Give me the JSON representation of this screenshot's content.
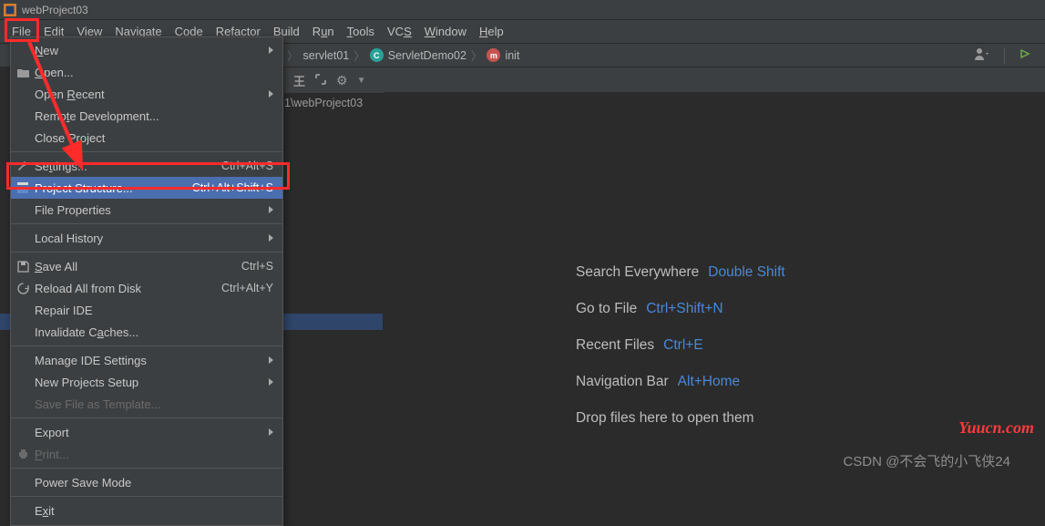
{
  "titlebar": {
    "title": "webProject03"
  },
  "menubar": {
    "file": "File",
    "edit": "Edit",
    "view": "View",
    "navigate": "Navigate",
    "code": "Code",
    "refactor": "Refactor",
    "build": "Build",
    "run": "Run",
    "tools": "Tools",
    "vcs": "VCS",
    "window": "Window",
    "help": "Help"
  },
  "breadcrumbs": {
    "b1": "servlet01",
    "b2": "ServletDemo02",
    "b3": "init"
  },
  "toolbar2": {
    "path_fragment": "1\\webProject03"
  },
  "filemenu": {
    "new": "New",
    "open": "Open...",
    "open_recent": "Open Recent",
    "remote_dev": "Remote Development...",
    "close_project": "Close Project",
    "settings": "Settings...",
    "settings_sc": "Ctrl+Alt+S",
    "proj_struct": "Project Structure...",
    "proj_struct_sc": "Ctrl+Alt+Shift+S",
    "file_props": "File Properties",
    "local_history": "Local History",
    "save_all": "Save All",
    "save_all_sc": "Ctrl+S",
    "reload": "Reload All from Disk",
    "reload_sc": "Ctrl+Alt+Y",
    "repair": "Repair IDE",
    "invalidate": "Invalidate Caches...",
    "manage_ide": "Manage IDE Settings",
    "new_proj_setup": "New Projects Setup",
    "save_tpl": "Save File as Template...",
    "export": "Export",
    "print": "Print...",
    "power_save": "Power Save Mode",
    "exit": "Exit"
  },
  "hints": {
    "search": "Search Everywhere",
    "search_kb": "Double Shift",
    "goto": "Go to File",
    "goto_kb": "Ctrl+Shift+N",
    "recent": "Recent Files",
    "recent_kb": "Ctrl+E",
    "navbar": "Navigation Bar",
    "navbar_kb": "Alt+Home",
    "drop": "Drop files here to open them"
  },
  "icons": {
    "gear": "⚙"
  },
  "watermark": {
    "csdn": "CSDN @不会飞的小飞侠24",
    "yuucn": "Yuucn.com"
  }
}
